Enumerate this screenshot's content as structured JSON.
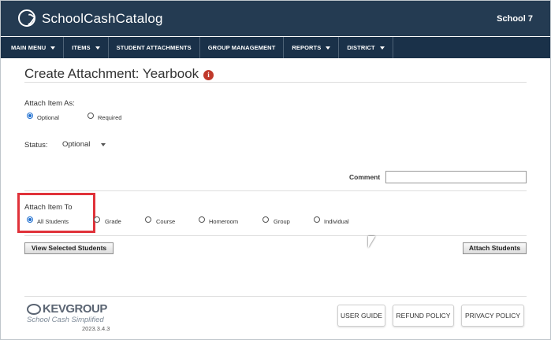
{
  "header": {
    "app_title": "SchoolCashCatalog",
    "school": "School 7"
  },
  "nav": {
    "items": [
      {
        "label": "MAIN MENU",
        "dropdown": true
      },
      {
        "label": "ITEMS",
        "dropdown": true
      },
      {
        "label": "STUDENT ATTACHMENTS",
        "dropdown": false
      },
      {
        "label": "GROUP MANAGEMENT",
        "dropdown": false
      },
      {
        "label": "REPORTS",
        "dropdown": true
      },
      {
        "label": "DISTRICT",
        "dropdown": true
      }
    ]
  },
  "page": {
    "title": "Create Attachment: Yearbook",
    "info_icon_text": "i"
  },
  "attach_as": {
    "label": "Attach Item As:",
    "options": [
      "Optional",
      "Required"
    ],
    "selected": "Optional"
  },
  "status": {
    "label": "Status:",
    "value": "Optional"
  },
  "comment": {
    "label": "Comment",
    "value": ""
  },
  "attach_to": {
    "label": "Attach Item To",
    "options": [
      "All Students",
      "Grade",
      "Course",
      "Homeroom",
      "Group",
      "Individual"
    ],
    "selected": "All Students"
  },
  "buttons": {
    "view_selected": "View Selected Students",
    "attach_students": "Attach Students"
  },
  "footer": {
    "brand_name": "KEVGROUP",
    "tagline": "School Cash Simplified",
    "version": "2023.3.4.3",
    "user_guide": "USER GUIDE",
    "refund_policy": "REFUND POLICY",
    "privacy_policy": "PRIVACY POLICY"
  },
  "colors": {
    "header_bg": "#243b52",
    "nav_bg": "#1a3149",
    "highlight": "#e0323a",
    "radio_selected": "#1f6fd0"
  }
}
